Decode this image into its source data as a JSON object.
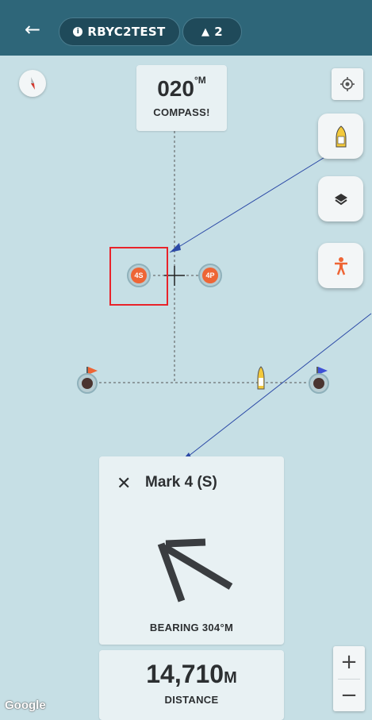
{
  "header": {
    "back_icon": "arrow-left-icon",
    "session_name": "RBYC2TEST",
    "participants_count": "2"
  },
  "map": {
    "heading_value": "020",
    "heading_unit": "°M",
    "heading_label": "COMPASS!",
    "marks": {
      "starboard_label": "4S",
      "port_label": "4P"
    },
    "colors": {
      "water": "#c6dfe5",
      "header": "#2e6679",
      "mark_orange": "#ee6535",
      "annotation_red": "#e8232a",
      "annotation_blue": "#2b49a6"
    }
  },
  "navigation": {
    "close_icon": "close-icon",
    "target_title": "Mark 4 (S)",
    "bearing_label": "BEARING 304°M",
    "distance_value": "14,710",
    "distance_unit": "M",
    "distance_label": "DISTANCE"
  },
  "controls": {
    "zoom_in_label": "+",
    "zoom_out_label": "−",
    "map_attribution": "Google"
  }
}
